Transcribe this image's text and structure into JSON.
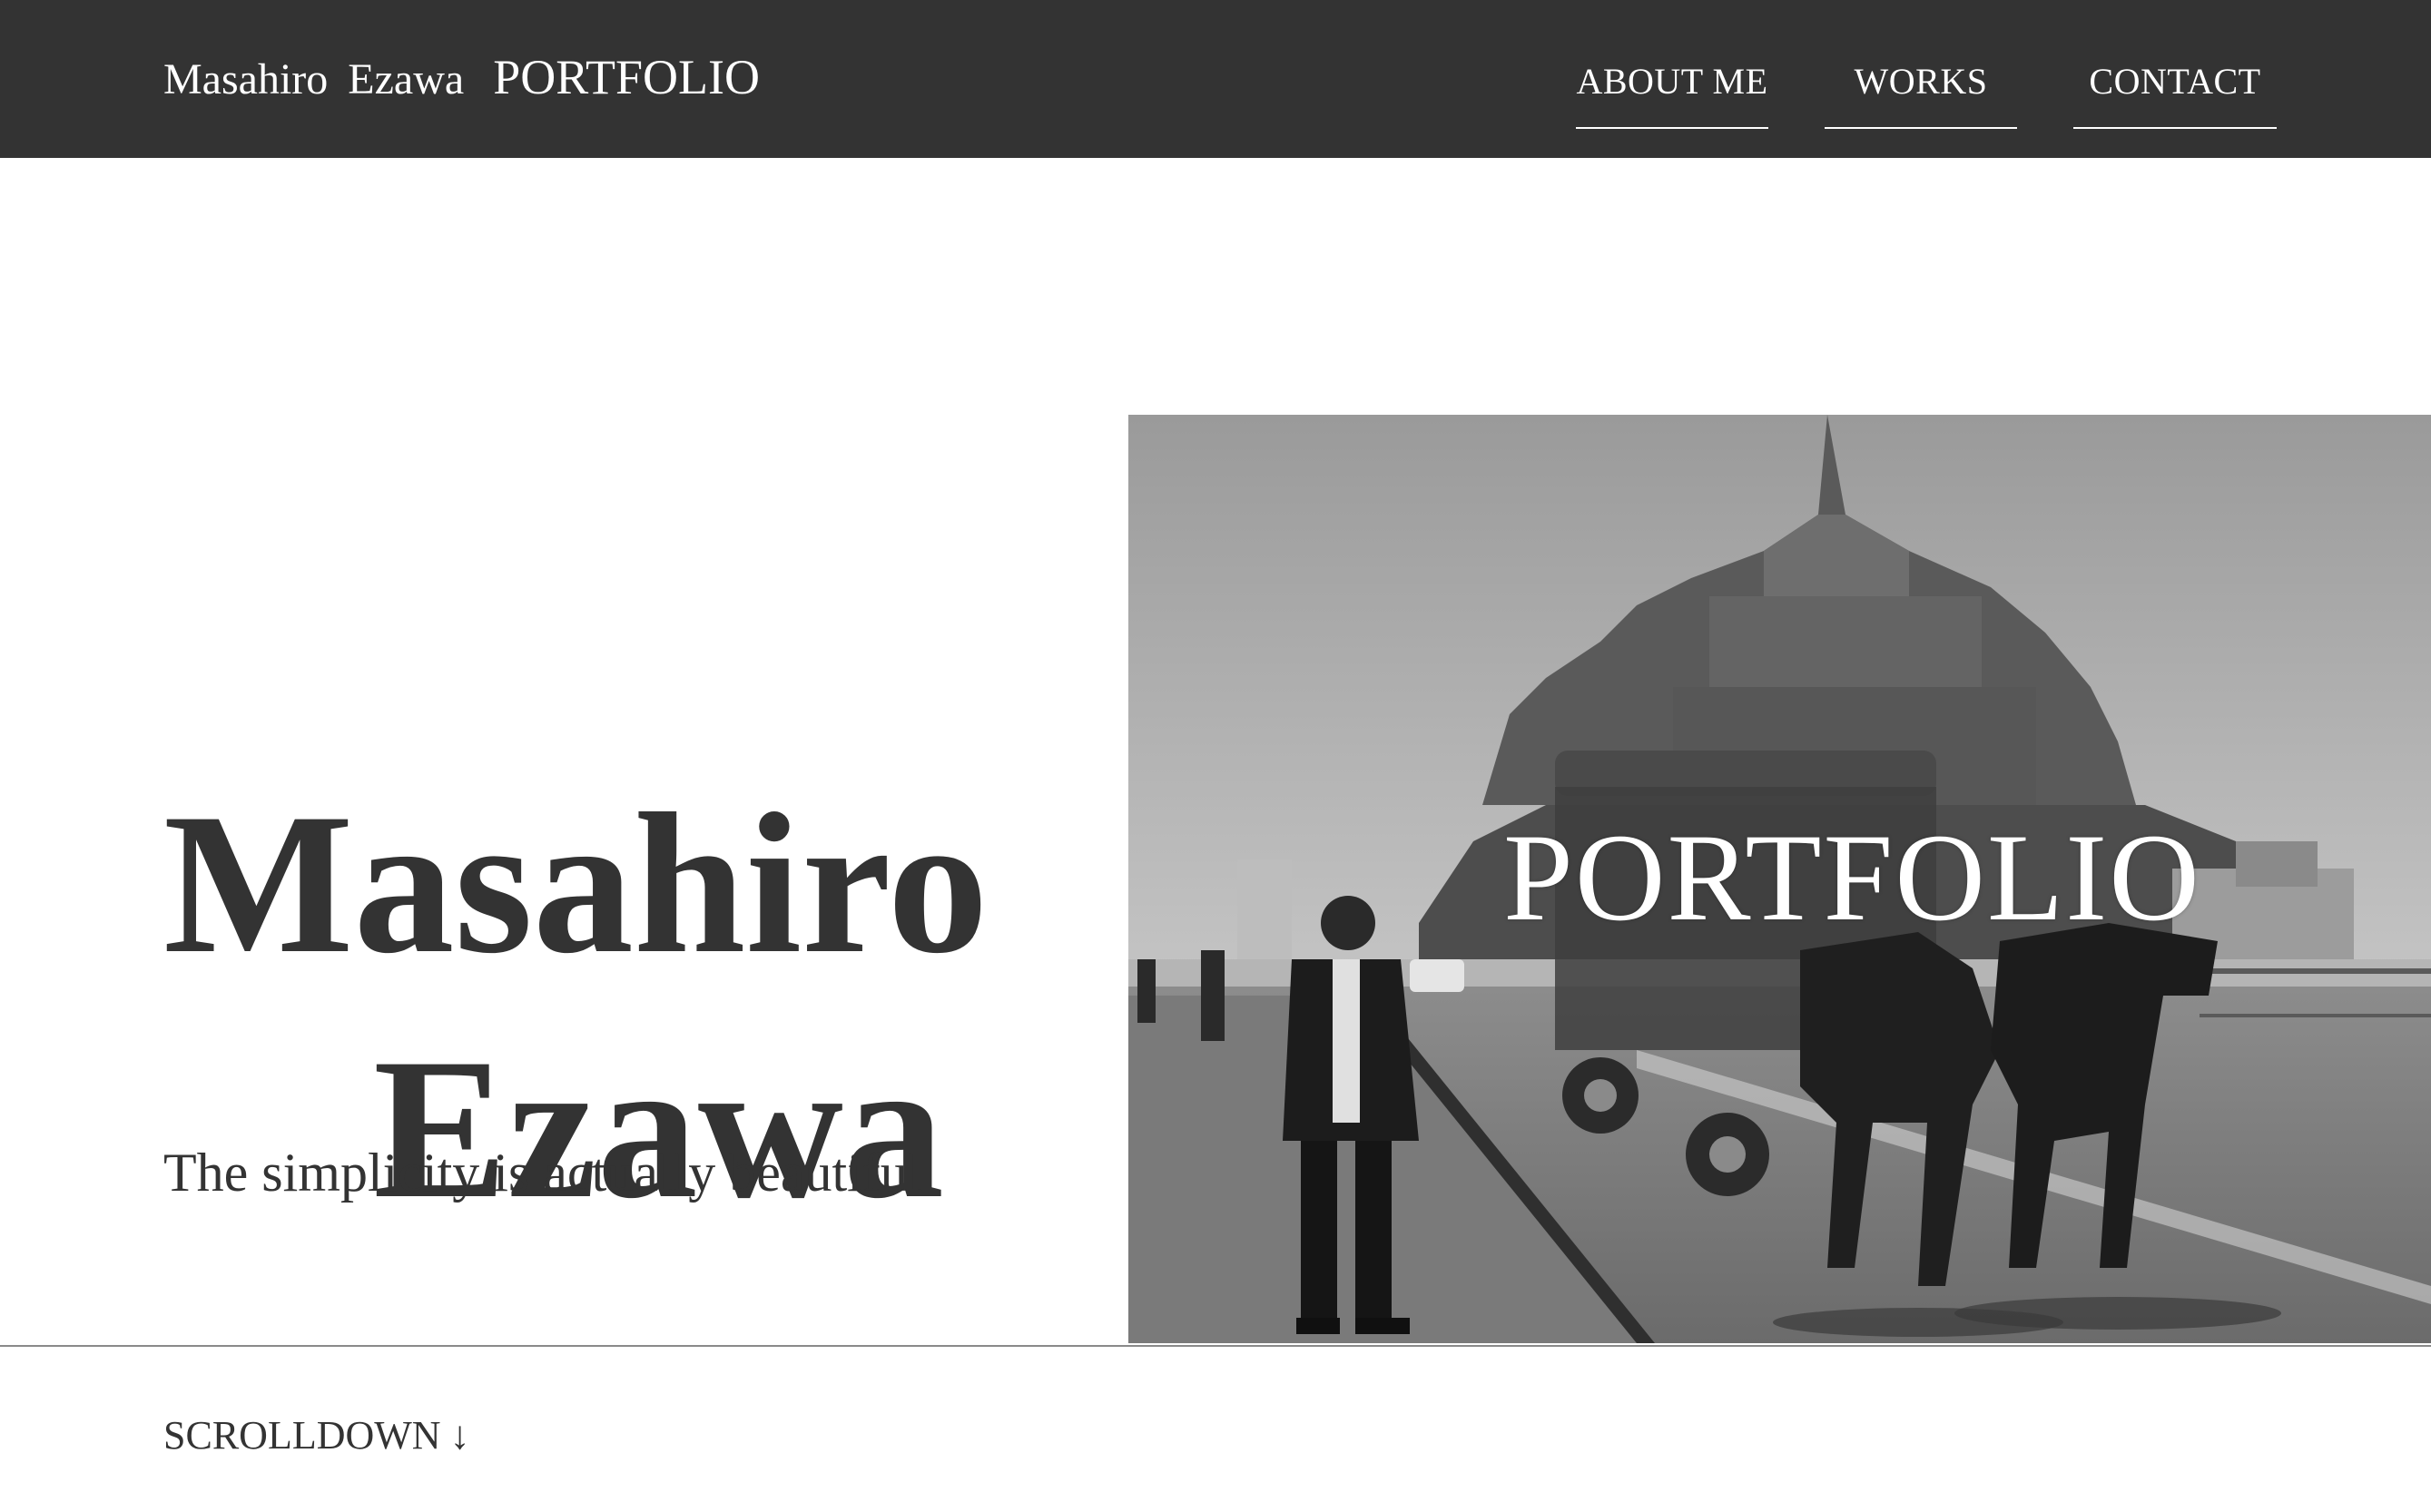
{
  "header": {
    "brand": {
      "first_name": "Masahiro",
      "last_name": "Ezawa",
      "suffix": "PORTFOLIO"
    },
    "nav": [
      {
        "label": "ABOUT ME"
      },
      {
        "label": "WORKS"
      },
      {
        "label": "CONTACT"
      }
    ]
  },
  "hero": {
    "name_line1": "Masahiro",
    "name_line2": "Ezawa",
    "tagline": "The simplicity is actually beautiful",
    "photo_title": "PORTFOLIO"
  },
  "footer": {
    "scroll_label": "SCROLLDOWN",
    "scroll_arrow": "↓"
  },
  "colors": {
    "header_bg": "#333333",
    "text": "#333333",
    "nav_text": "#ffffff",
    "page_bg": "#ffffff"
  },
  "icons": {
    "scroll": "down-arrow-icon"
  }
}
